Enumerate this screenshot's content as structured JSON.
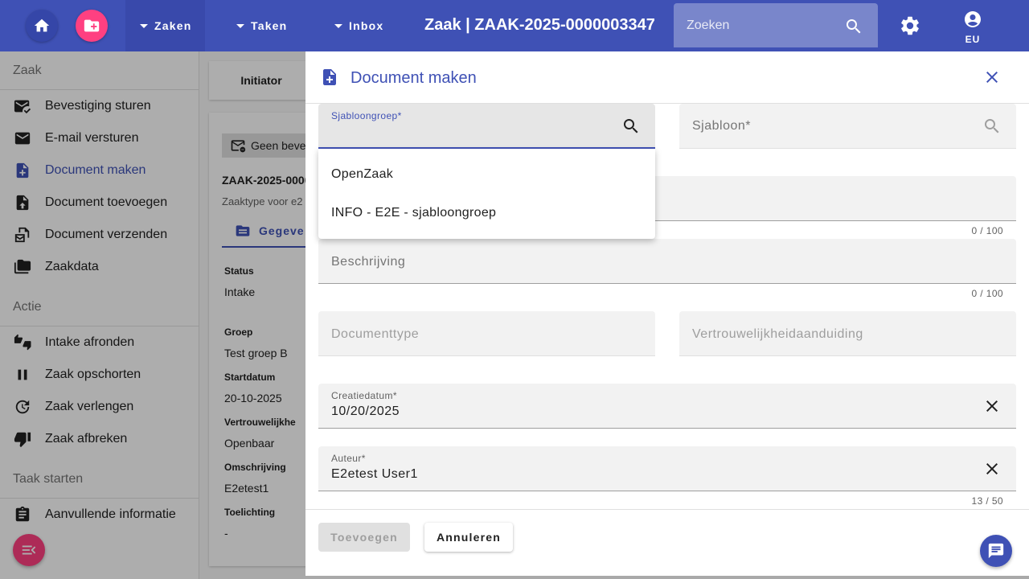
{
  "topbar": {
    "home_icon": "home-icon",
    "create_icon": "create-zaak-icon",
    "menus": [
      {
        "label": "Zaken"
      },
      {
        "label": "Taken"
      },
      {
        "label": "Inbox"
      }
    ],
    "title": "Zaak | ZAAK-2025-0000003347",
    "search_placeholder": "Zoeken",
    "account_label": "EU",
    "colors": {
      "primary": "#3f51b5",
      "accent": "#ff4081"
    }
  },
  "sidebar": {
    "sections": [
      {
        "title": "Zaak",
        "items": [
          {
            "label": "Bevestiging sturen",
            "icon": "mark-email-read-icon"
          },
          {
            "label": "E-mail versturen",
            "icon": "mail-icon"
          },
          {
            "label": "Document maken",
            "icon": "note-add-icon",
            "active": true
          },
          {
            "label": "Document toevoegen",
            "icon": "upload-file-icon"
          },
          {
            "label": "Document verzenden",
            "icon": "send-document-icon"
          },
          {
            "label": "Zaakdata",
            "icon": "folder-copy-icon"
          }
        ]
      },
      {
        "title": "Actie",
        "items": [
          {
            "label": "Intake afronden",
            "icon": "thumbs-up-down-icon"
          },
          {
            "label": "Zaak opschorten",
            "icon": "pause-icon"
          },
          {
            "label": "Zaak verlengen",
            "icon": "update-icon"
          },
          {
            "label": "Zaak afbreken",
            "icon": "thumb-down-icon"
          }
        ]
      },
      {
        "title": "Taak starten",
        "items": [
          {
            "label": "Aanvullende informatie",
            "icon": "assignment-icon"
          }
        ]
      }
    ]
  },
  "background": {
    "card_label": "Initiator",
    "chip_label": "Geen beve",
    "zaak_id": "ZAAK-2025-0000",
    "zaaktype": "Zaaktype voor e2",
    "tab_label": "Gegeve",
    "fields": [
      {
        "label": "Status",
        "value": "Intake"
      },
      {
        "label": "Groep",
        "value": "Test groep B"
      },
      {
        "label": "Startdatum",
        "value": "20-10-2025"
      },
      {
        "label": "Vertrouwelijkhe",
        "value": "Openbaar"
      },
      {
        "label": "Omschrijving",
        "value": "E2etest1"
      },
      {
        "label": "Toelichting",
        "value": "-"
      }
    ]
  },
  "dialog": {
    "title": "Document maken",
    "sjabloongroep": {
      "label": "Sjabloongroep*",
      "value": ""
    },
    "sjabloon": {
      "placeholder": "Sjabloon*"
    },
    "titel": {
      "counter": "0 / 100"
    },
    "beschrijving": {
      "placeholder": "Beschrijving",
      "counter": "0 / 100"
    },
    "documenttype": {
      "placeholder": "Documenttype"
    },
    "vertrouwelijkheid": {
      "placeholder": "Vertrouwelijkheidaanduiding"
    },
    "creatiedatum": {
      "label": "Creatiedatum*",
      "value": "10/20/2025"
    },
    "auteur": {
      "label": "Auteur*",
      "value": "E2etest User1",
      "counter": "13 / 50"
    },
    "dropdown_options": [
      "OpenZaak",
      "INFO - E2E - sjabloongroep"
    ],
    "add_button": "Toevoegen",
    "cancel_button": "Annuleren"
  }
}
